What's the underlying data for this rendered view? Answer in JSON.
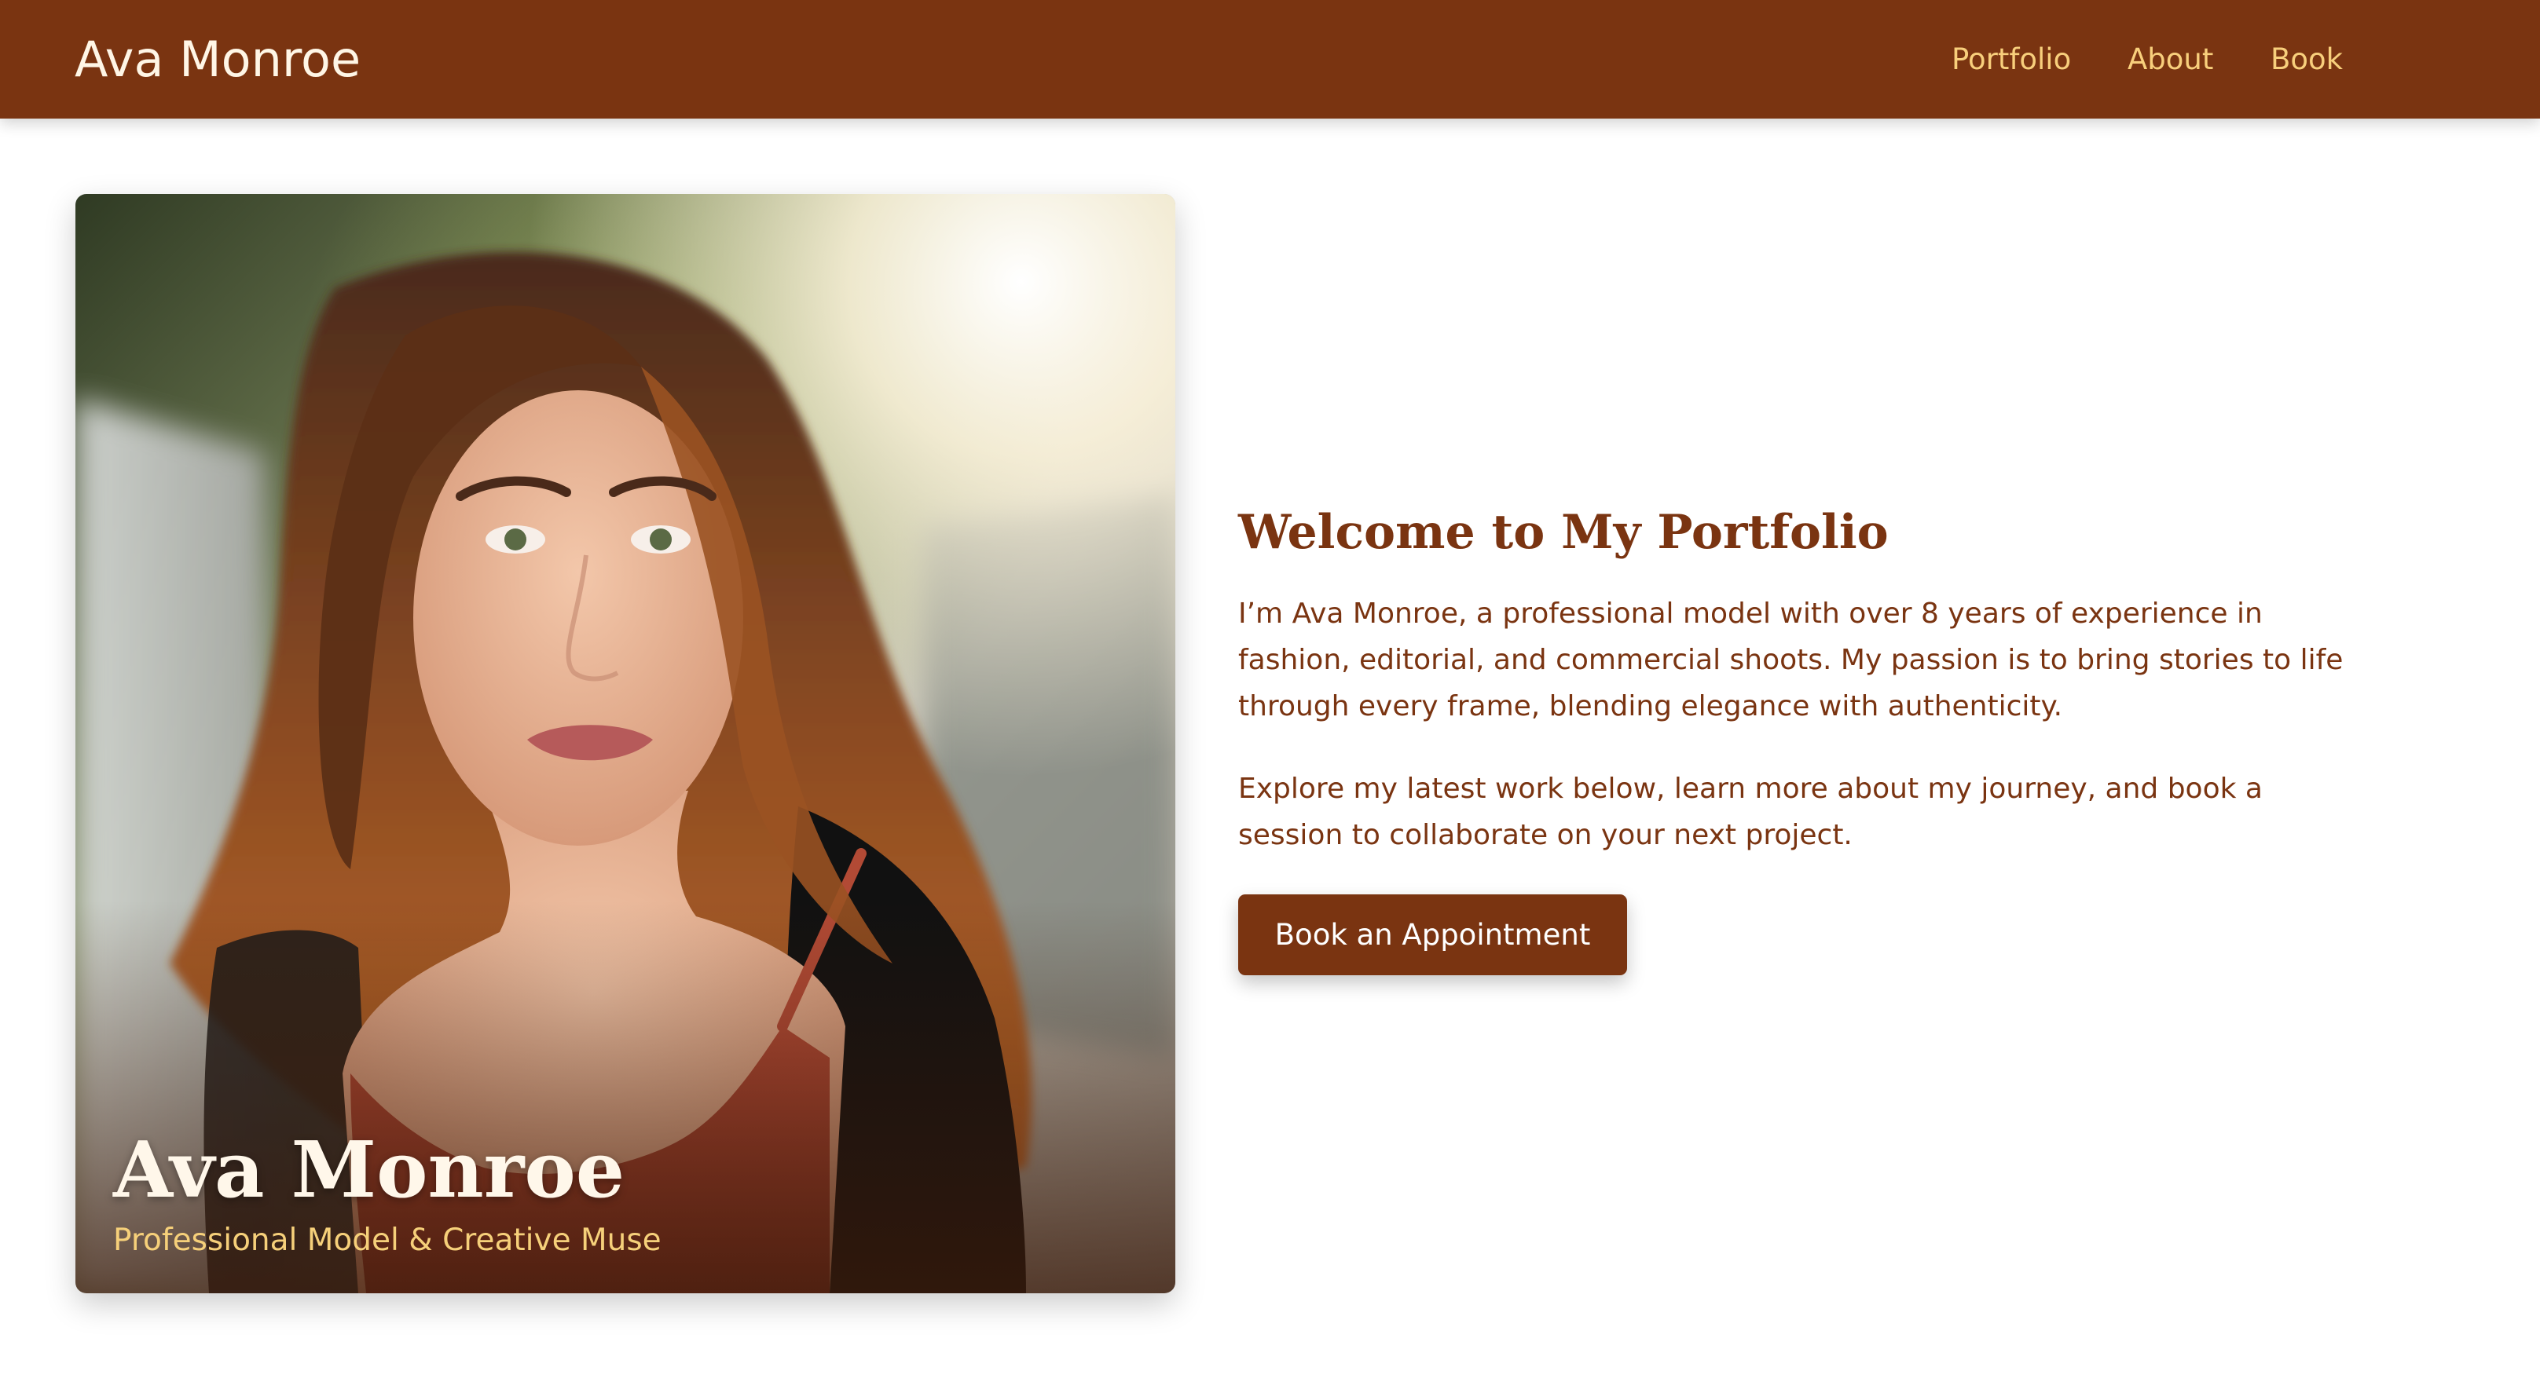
{
  "header": {
    "brand": "Ava Monroe",
    "nav": [
      {
        "label": "Portfolio"
      },
      {
        "label": "About"
      },
      {
        "label": "Book"
      }
    ]
  },
  "hero": {
    "name": "Ava Monroe",
    "subtitle": "Professional Model & Creative Muse"
  },
  "intro": {
    "title": "Welcome to My Portfolio",
    "paragraphs": [
      "I’m Ava Monroe, a professional model with over 8 years of experience in fashion, editorial, and commercial shoots. My passion is to bring stories to life through every frame, blending elegance with authenticity.",
      "Explore my latest work below, learn more about my journey, and book a session to collaborate on your next project."
    ],
    "cta_label": "Book an Appointment"
  },
  "colors": {
    "brand_brown": "#7a3411",
    "nav_gold": "#f8cf7c",
    "subtitle_gold": "#f6d07a",
    "background": "#ffffff"
  }
}
